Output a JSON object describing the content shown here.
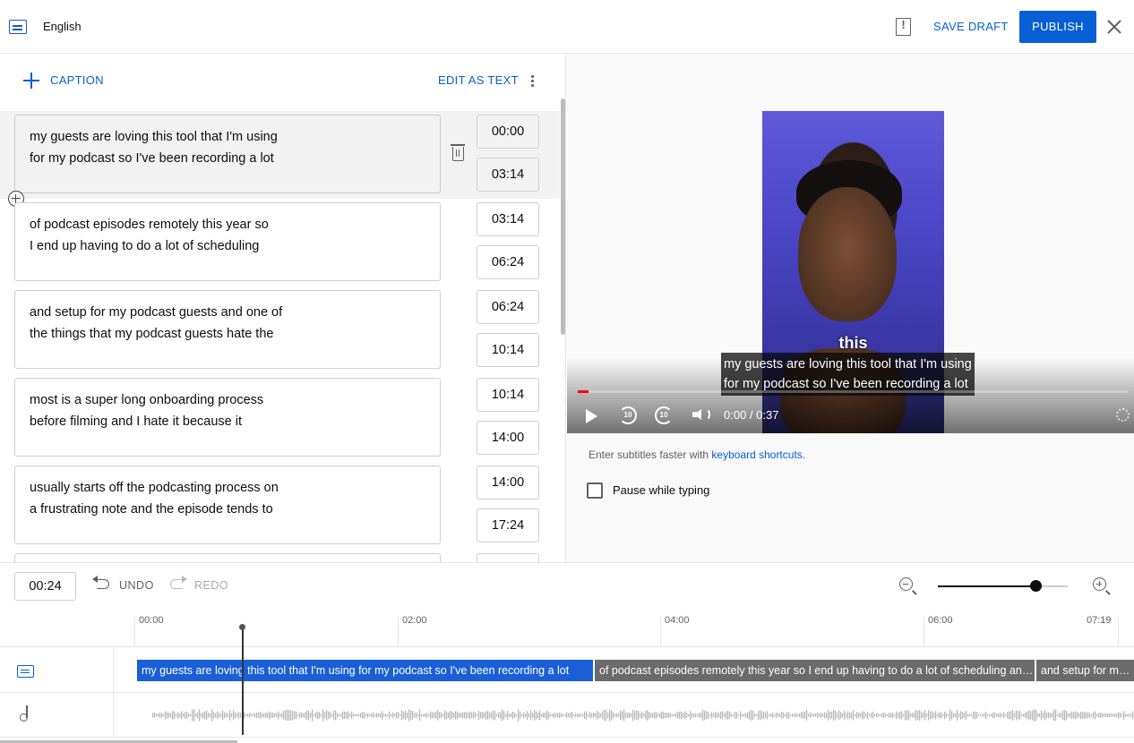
{
  "header": {
    "language": "English",
    "save_draft": "SAVE DRAFT",
    "publish": "PUBLISH"
  },
  "toolbar": {
    "add_caption": "CAPTION",
    "edit_as_text": "EDIT AS TEXT"
  },
  "captions": [
    {
      "line1": "my guests are loving this tool that I'm using",
      "line2": "for my podcast so I've been recording a lot",
      "start": "00:00",
      "end": "03:14"
    },
    {
      "line1": "of podcast episodes remotely this year so",
      "line2": "I end up having to do a lot of scheduling",
      "start": "03:14",
      "end": "06:24"
    },
    {
      "line1": "and setup for my podcast guests and one of",
      "line2": "the things that my podcast guests hate the",
      "start": "06:24",
      "end": "10:14"
    },
    {
      "line1": "most is a super long onboarding process",
      "line2": "before filming and I hate it because it",
      "start": "10:14",
      "end": "14:00"
    },
    {
      "line1": "usually starts off the podcasting process on",
      "line2": "a frustrating note and the episode tends to",
      "start": "14:00",
      "end": "17:24"
    }
  ],
  "player": {
    "burned_in_word": "this",
    "subtitle_line1": "my guests are loving this tool that I'm using",
    "subtitle_line2": "for my podcast so I've been recording a lot",
    "rewind_label": "10",
    "forward_label": "10",
    "time_display": "0:00 / 0:37",
    "progress_fraction": 0.02
  },
  "tip": {
    "text": "Enter subtitles faster with ",
    "link": "keyboard shortcuts",
    "suffix": "."
  },
  "pause_while_typing": {
    "label": "Pause while typing",
    "checked": false
  },
  "timeline": {
    "current_time": "00:24",
    "undo": "UNDO",
    "redo": "REDO",
    "zoom_level_fraction": 0.76,
    "ticks": [
      "00:00",
      "02:00",
      "04:00",
      "06:00",
      "07:19"
    ],
    "segments": [
      "my guests are loving this tool that I'm using  for my podcast so I've been recording a lot",
      "of podcast episodes remotely this year so  I end up having to do a lot of scheduling and setup",
      "and setup for my podcast guests"
    ]
  },
  "colors": {
    "accent": "#065fd4",
    "active_segment": "#1a5fd6",
    "progress": "#ff0000"
  }
}
